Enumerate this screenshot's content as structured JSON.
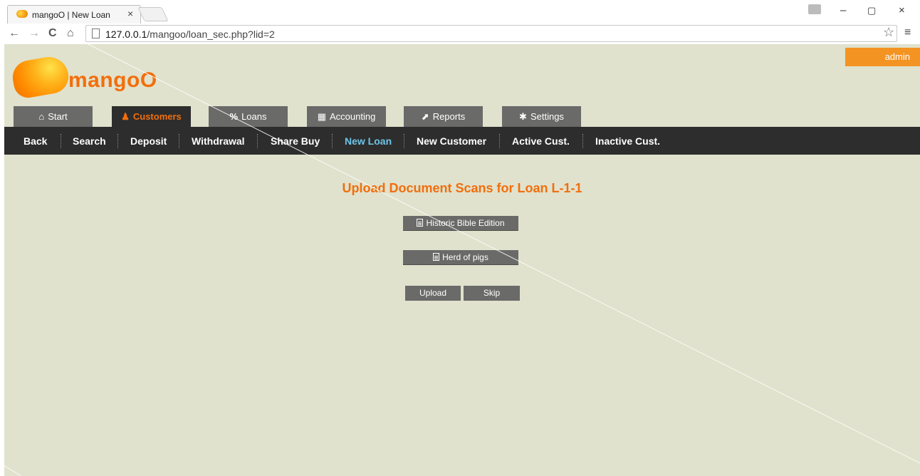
{
  "browser": {
    "tab_title": "mangoO | New Loan",
    "tab_close": "×",
    "url_host": "127.0.0.1",
    "url_path": "/mangoo/loan_sec.php?lid=2",
    "back": "←",
    "forward": "→",
    "reload": "C",
    "home": "⌂",
    "star": "☆",
    "menu": "≡",
    "minimize": "–",
    "restore": "▢",
    "close": "×"
  },
  "header": {
    "logo_text": "mangoO",
    "user": "admin"
  },
  "main_tabs": [
    {
      "label": "Start",
      "icon": "home-icon",
      "glyph": "⌂"
    },
    {
      "label": "Customers",
      "icon": "user-icon",
      "glyph": "♟"
    },
    {
      "label": "Loans",
      "icon": "percent-icon",
      "glyph": "%"
    },
    {
      "label": "Accounting",
      "icon": "calculator-icon",
      "glyph": "▦"
    },
    {
      "label": "Reports",
      "icon": "chart-icon",
      "glyph": "⬈"
    },
    {
      "label": "Settings",
      "icon": "gear-icon",
      "glyph": "✱"
    }
  ],
  "sub_nav": [
    "Back",
    "Search",
    "Deposit",
    "Withdrawal",
    "Share Buy",
    "New Loan",
    "New Customer",
    "Active Cust.",
    "Inactive Cust."
  ],
  "content": {
    "heading": "Upload Document Scans for Loan L-1-1",
    "files": [
      "Historic Bible Edition",
      "Herd of pigs"
    ],
    "upload_label": "Upload",
    "skip_label": "Skip"
  },
  "colors": {
    "page_bg": "#e0e2cd",
    "accent": "#f26e0c",
    "nav_dark": "#2d2d2d",
    "tab_grey": "#6a6a69",
    "active_link": "#6ec4e8"
  }
}
